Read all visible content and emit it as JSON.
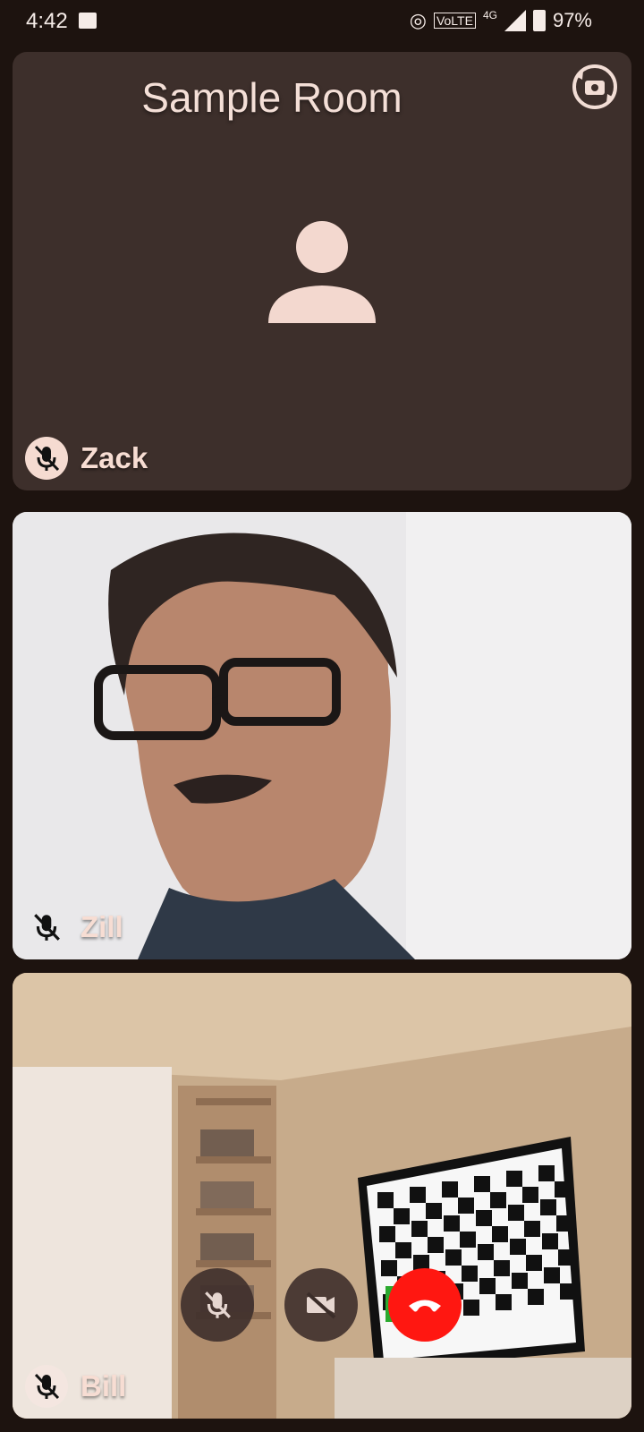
{
  "status_bar": {
    "time": "4:42",
    "volte": "VoLTE",
    "network": "4G",
    "battery": "97%"
  },
  "room": {
    "title": "Sample Room"
  },
  "participants": [
    {
      "name": "Zack",
      "muted": true,
      "video": false
    },
    {
      "name": "Zill",
      "muted": true,
      "video": true
    },
    {
      "name": "Bill",
      "muted": true,
      "video": true
    }
  ],
  "controls": {
    "mic": "muted",
    "camera": "off",
    "end_call": "end-call"
  },
  "colors": {
    "background": "#1d130f",
    "tile": "#3d2f2b",
    "accent": "#f3dcd3",
    "end_call": "#ff1711"
  }
}
